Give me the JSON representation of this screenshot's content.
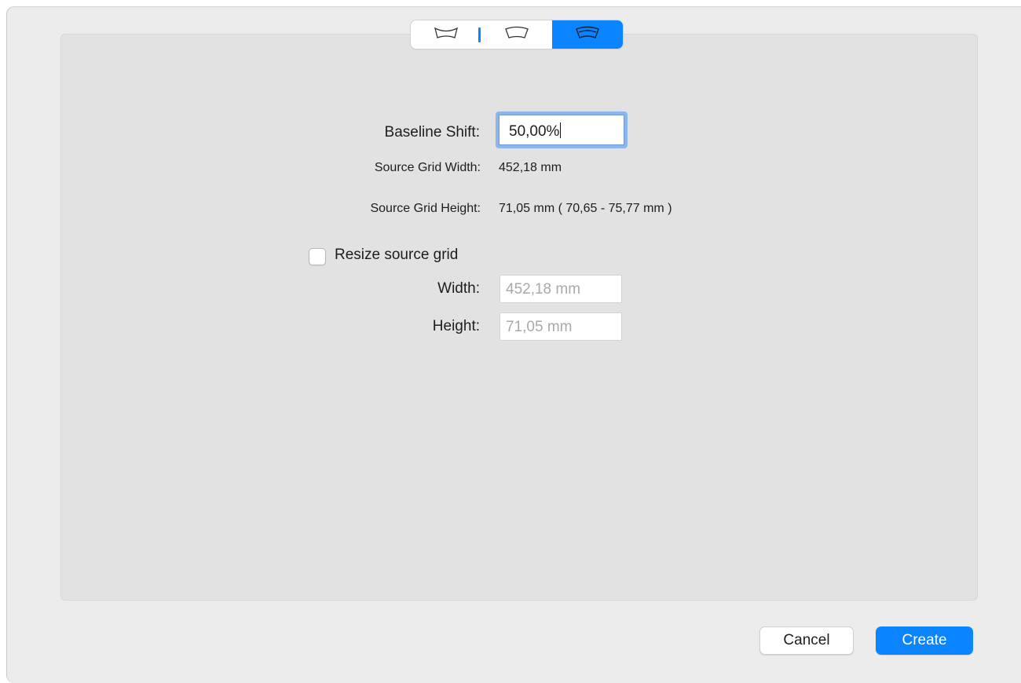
{
  "mode_selector": {
    "segments": [
      {
        "icon": "arch-up-shape-icon",
        "selected": false
      },
      {
        "icon": "arch-down-shape-icon",
        "selected": false
      },
      {
        "icon": "arch-baseline-shape-icon",
        "selected": true
      }
    ]
  },
  "form": {
    "baseline_shift_label": "Baseline Shift:",
    "baseline_shift_value": "50,00%",
    "source_grid_width_label": "Source Grid Width:",
    "source_grid_width_value": "452,18 mm",
    "source_grid_height_label": "Source Grid Height:",
    "source_grid_height_value": "71,05 mm ( 70,65 - 75,77 mm )",
    "resize_checkbox_label": "Resize source grid",
    "resize_checked": false,
    "width_label": "Width:",
    "width_value": "452,18 mm",
    "height_label": "Height:",
    "height_value": "71,05 mm"
  },
  "buttons": {
    "cancel_label": "Cancel",
    "create_label": "Create"
  },
  "colors": {
    "accent": "#0a84ff",
    "window_bg": "#ececec",
    "panel_bg": "#e2e2e2",
    "disabled_text": "#a9a9a9"
  }
}
